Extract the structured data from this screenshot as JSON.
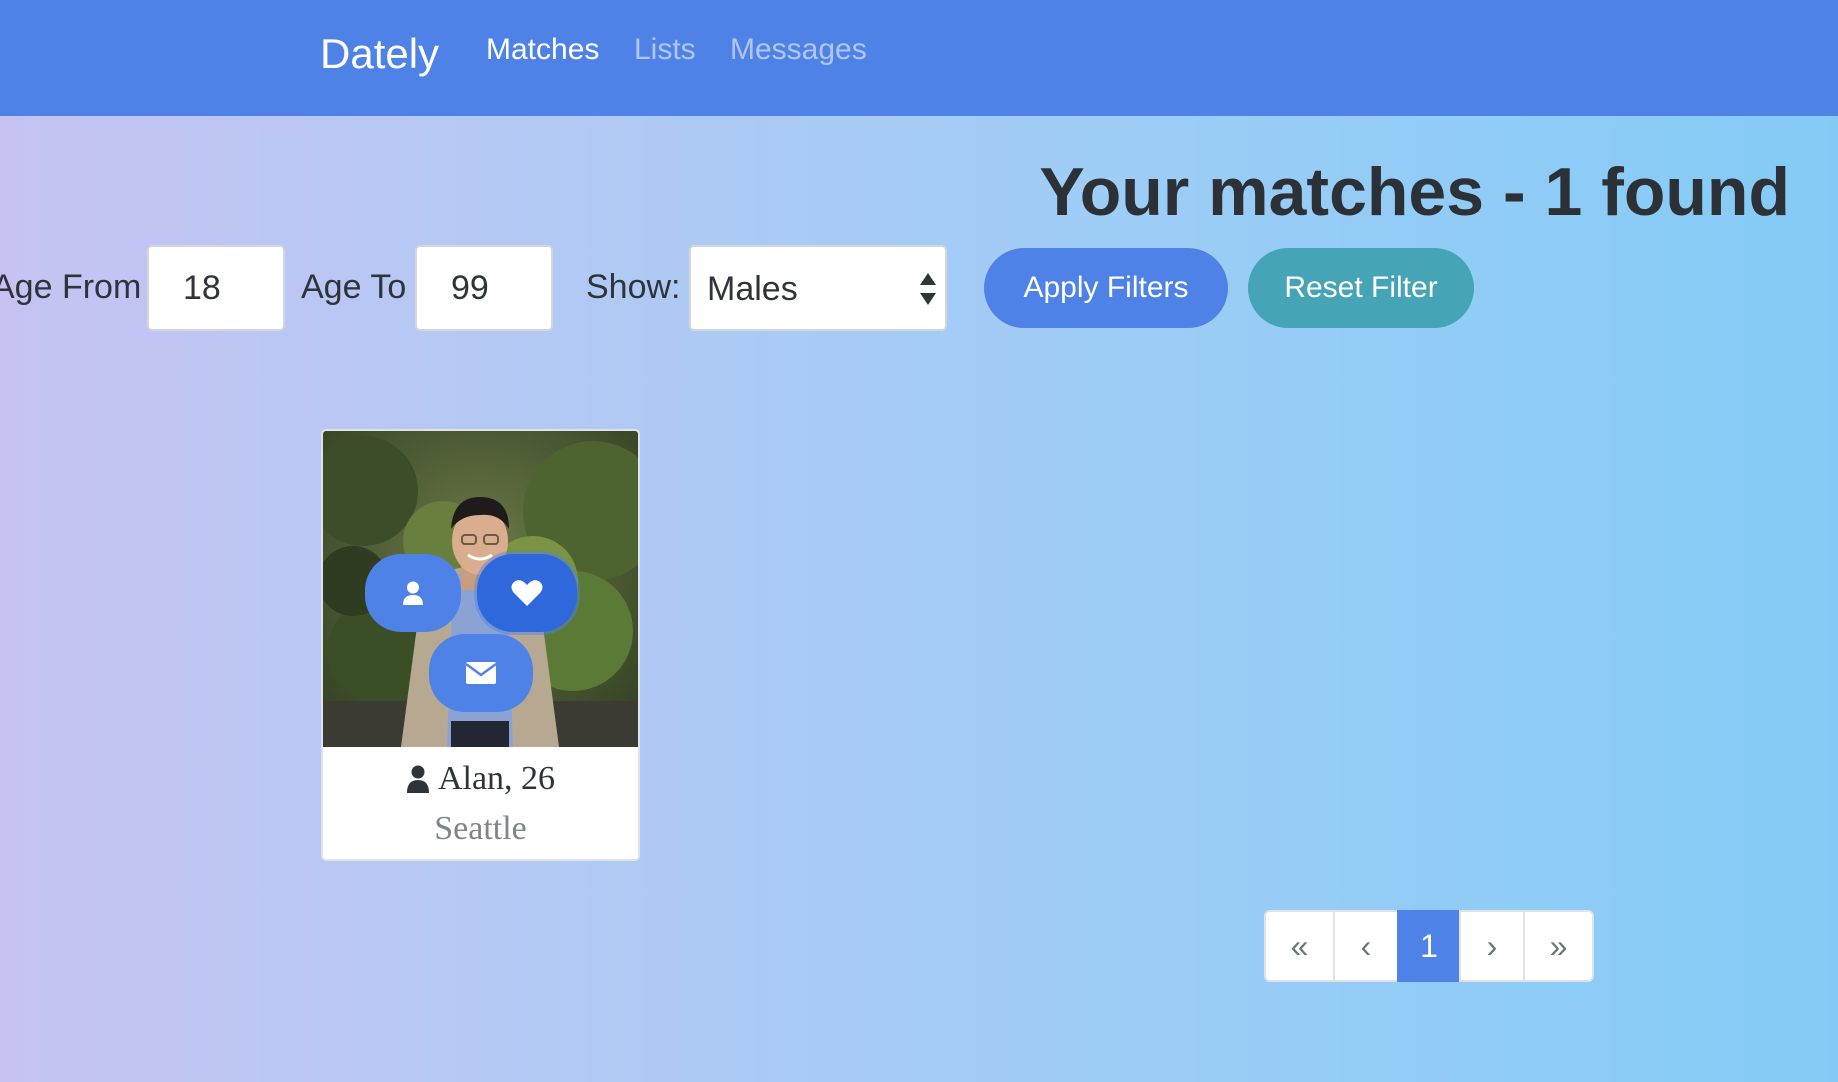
{
  "navbar": {
    "brand": "Dately",
    "links": [
      "Matches",
      "Lists",
      "Messages"
    ]
  },
  "page": {
    "title": "Your matches - 1 found"
  },
  "filters": {
    "age_from_label": "Age From",
    "age_from_value": "18",
    "age_to_label": "Age To",
    "age_to_value": "99",
    "show_label": "Show:",
    "show_value": "Males",
    "apply_label": "Apply Filters",
    "reset_label": "Reset Filter"
  },
  "members": [
    {
      "name_age": "Alan, 26",
      "city": "Seattle"
    }
  ],
  "pagination": {
    "first": "«",
    "prev": "‹",
    "current": "1",
    "next": "›",
    "last": "»"
  },
  "colors": {
    "primary": "#4f82e6",
    "info": "#45a4b5",
    "text_dark": "#2c3138"
  },
  "icons": [
    "user-icon",
    "heart-icon",
    "envelope-icon",
    "user-icon"
  ]
}
